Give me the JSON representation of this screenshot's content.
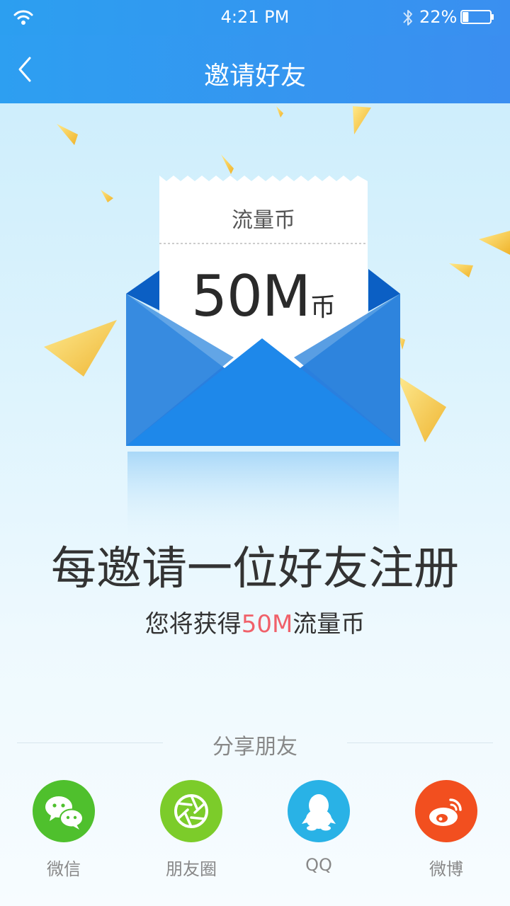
{
  "status_bar": {
    "time": "4:21 PM",
    "battery_percent": "22%",
    "battery_level": 0.22,
    "icons": [
      "wifi-icon",
      "bluetooth-icon",
      "battery-icon"
    ]
  },
  "nav": {
    "title": "邀请好友",
    "back_icon": "chevron-left-icon"
  },
  "ticket": {
    "label": "流量币",
    "amount": "50M",
    "unit": "币"
  },
  "headline": "每邀请一位好友注册",
  "subline": {
    "prefix": "您将获得",
    "highlight": "50M",
    "suffix": "流量币"
  },
  "share": {
    "title": "分享朋友",
    "items": [
      {
        "label": "微信",
        "icon": "wechat-icon",
        "color": "#4fc02d"
      },
      {
        "label": "朋友圈",
        "icon": "moments-icon",
        "color": "#7ccc2a"
      },
      {
        "label": "QQ",
        "icon": "qq-icon",
        "color": "#29b2e6"
      },
      {
        "label": "微博",
        "icon": "weibo-icon",
        "color": "#f24f1f"
      }
    ]
  },
  "colors": {
    "bar_blue": "#2d9ff1",
    "highlight_red": "#f0616a",
    "envelope_blue": "#1e88e5"
  }
}
